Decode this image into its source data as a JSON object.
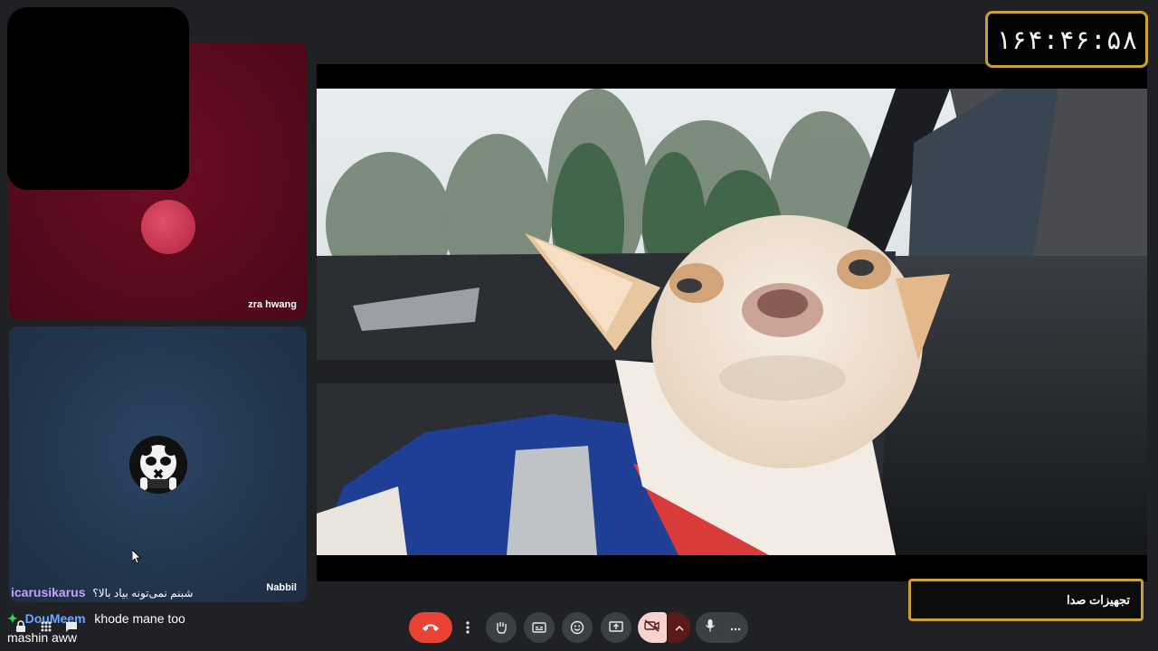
{
  "timer": {
    "text": "۱۶۴:۴۶:۵۸"
  },
  "participants": [
    {
      "name": "zra hwang"
    },
    {
      "name": "Nabbil"
    }
  ],
  "chat": [
    {
      "user": "icarusikarus",
      "message": "شبنم نمی‌تونه بیاد بالا؟"
    },
    {
      "user": "DouMeem",
      "message": "khode mane too"
    },
    {
      "user": "",
      "message": "mashin aww"
    }
  ],
  "audio_panel": {
    "label": "تجهیزات صدا"
  },
  "controls": {
    "end_call": "call-end-icon",
    "more": "more-vert-icon",
    "raise_hand": "hand-icon",
    "captions": "closed-captions-icon",
    "emoji": "emoji-icon",
    "present": "present-screen-icon",
    "camera": "camera-off-icon",
    "camera_options": "chevron-up-icon",
    "mic": "mic-icon",
    "mic_options": "more-horiz-icon"
  },
  "colors": {
    "accent_gold": "#c8a13c",
    "end_call_red": "#ea4335",
    "camera_off_bg": "#f6d3d0",
    "chat_user1": "#c8a0ff",
    "chat_user2": "#6aa8ff"
  }
}
